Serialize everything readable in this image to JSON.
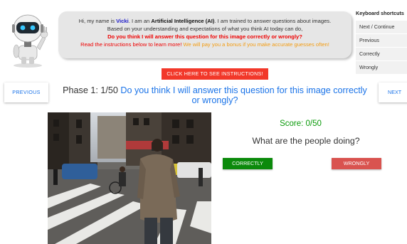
{
  "intro": {
    "l1_a": "Hi, my name is ",
    "name": "Vicki",
    "l1_b": ". I am an ",
    "ai": "Artificial Intelligence (AI)",
    "l1_c": ". I am trained to answer questions about images.",
    "l2": "Based on your understanding and expectations of what you think AI today can do,",
    "l3": "Do you think I will answer this question for this image correctly or wrongly?",
    "l4_a": "Read the instructions below to learn more! ",
    "l4_b": "We will pay you a bonus if you make accurate guesses often!"
  },
  "shortcuts": {
    "title": "Keyboard shortcuts",
    "items": [
      "Next / Continue",
      "Previous",
      "Correctly",
      "Wrongly"
    ]
  },
  "instructions_button": "CLICK HERE TO SEE INSTRUCTIONS!",
  "nav": {
    "previous": "PREVIOUS",
    "next": "NEXT"
  },
  "phase": {
    "prefix": "Phase 1: 1/50 ",
    "question": "Do you think I will answer this question for this image correctly or wrongly?"
  },
  "score": "Score: 0/50",
  "vqa_question": "What are the people doing?",
  "answers": {
    "correct": "CORRECTLY",
    "wrong": "WRONGLY"
  },
  "colors": {
    "accent_blue": "#1a73e8",
    "score_green": "#0a9a0a",
    "correct_green": "#0b8a0b",
    "wrong_red": "#d9534f",
    "instructions_red": "#f2382a"
  }
}
